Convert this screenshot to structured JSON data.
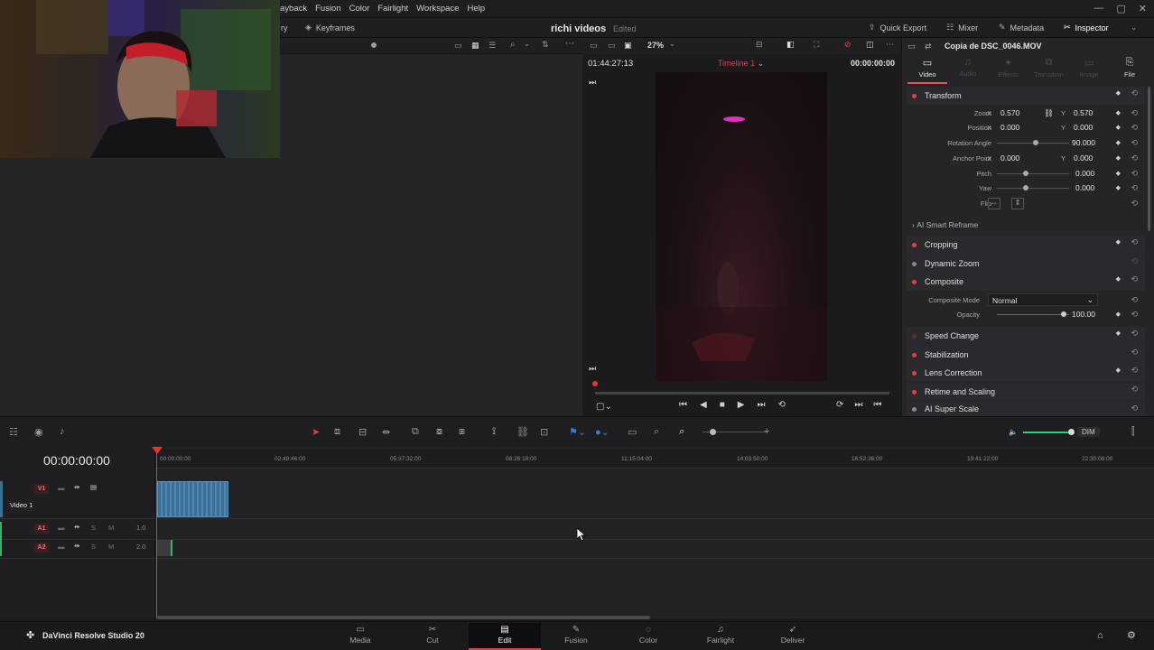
{
  "menu": [
    "ayback",
    "Fusion",
    "Color",
    "Fairlight",
    "Workspace",
    "Help"
  ],
  "window_controls": [
    "—",
    "▢",
    "✕"
  ],
  "toolbar": {
    "keyframes_label": "Keyframes",
    "left_partial": "ry",
    "project_title": "richi videos",
    "project_status": "Edited",
    "quick_export": "Quick Export",
    "mixer": "Mixer",
    "metadata": "Metadata",
    "inspector": "Inspector"
  },
  "viewer": {
    "zoom": "27%",
    "timecode_left": "01:44:27:13",
    "timeline_name": "Timeline 1",
    "timecode_right": "00:00:00:00"
  },
  "inspector": {
    "clip_name": "Copia de DSC_0046.MOV",
    "tabs": [
      {
        "label": "Video",
        "icon": "▭"
      },
      {
        "label": "Audio",
        "icon": "♫"
      },
      {
        "label": "Effects",
        "icon": "✦"
      },
      {
        "label": "Transition",
        "icon": "⧉"
      },
      {
        "label": "Image",
        "icon": "▭"
      },
      {
        "label": "File",
        "icon": "⎘"
      }
    ],
    "transform": {
      "title": "Transform",
      "zoom_label": "Zoom",
      "zoom_x": "0.570",
      "zoom_y": "0.570",
      "position_label": "Position",
      "position_x": "0.000",
      "position_y": "0.000",
      "rotation_label": "Rotation Angle",
      "rotation": "90.000",
      "anchor_label": "Anchor Point",
      "anchor_x": "0.000",
      "anchor_y": "0.000",
      "pitch_label": "Pitch",
      "pitch": "0.000",
      "yaw_label": "Yaw",
      "yaw": "0.000",
      "flip_label": "Flip",
      "x": "X",
      "y": "Y"
    },
    "ai_reframe": "AI Smart Reframe",
    "sections": {
      "cropping": "Cropping",
      "dynamic_zoom": "Dynamic Zoom",
      "composite": "Composite",
      "composite_mode_label": "Composite Mode",
      "composite_mode": "Normal",
      "opacity_label": "Opacity",
      "opacity": "100.00",
      "speed_change": "Speed Change",
      "stabilization": "Stabilization",
      "lens_correction": "Lens Correction",
      "retime": "Retime and Scaling",
      "super_scale": "AI Super Scale"
    }
  },
  "timeline": {
    "timecode": "00:00:00:00",
    "ruler": [
      "00:00:00:00",
      "02:48:46:00",
      "05:37:32:00",
      "08:26:18:00",
      "11:15:04:00",
      "14:03:50:00",
      "16:52:36:00",
      "19:41:22:00",
      "22:30:08:00"
    ],
    "v1_tag": "V1",
    "v1_name": "Video 1",
    "a1_tag": "A1",
    "a1_vol": "1.0",
    "a2_tag": "A2",
    "a2_vol": "2.0",
    "solo": "S",
    "mute": "M",
    "dim": "DIM"
  },
  "bottom": {
    "app_name": "DaVinci Resolve Studio 20",
    "pages": [
      {
        "label": "Media",
        "icon": "▭"
      },
      {
        "label": "Cut",
        "icon": "✂"
      },
      {
        "label": "Edit",
        "icon": "▤"
      },
      {
        "label": "Fusion",
        "icon": "✎"
      },
      {
        "label": "Color",
        "icon": "◌"
      },
      {
        "label": "Fairlight",
        "icon": "♫"
      },
      {
        "label": "Deliver",
        "icon": "➶"
      }
    ]
  }
}
